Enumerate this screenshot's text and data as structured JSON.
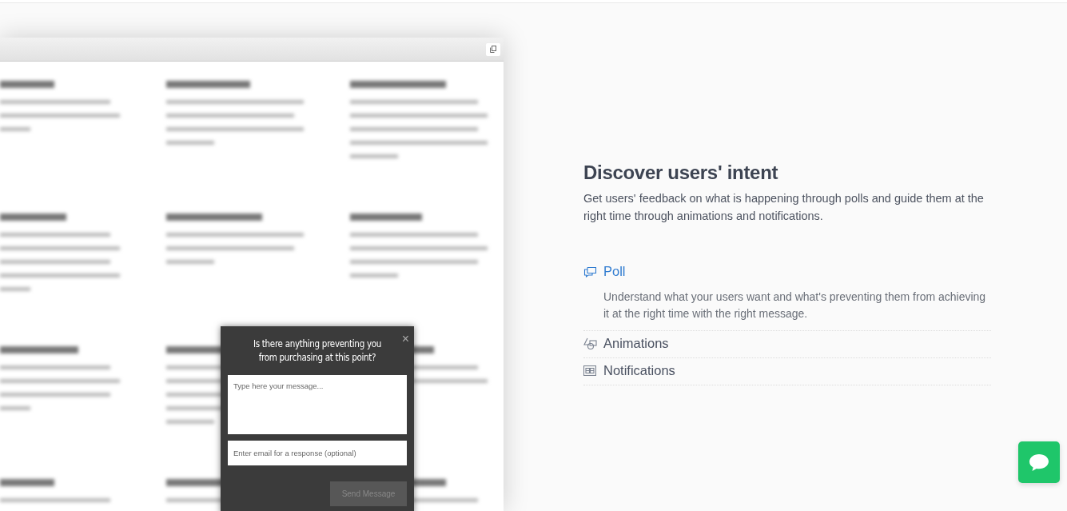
{
  "popup": {
    "title": "Is there anything preventing you from purchasing at this point?",
    "close": "×",
    "message_field": {
      "placeholder": "Type here your message..."
    },
    "email_field": {
      "placeholder": "Enter email for a response (optional)"
    },
    "send_button": "Send Message"
  },
  "feature": {
    "title": "Discover users' intent",
    "description": "Get users' feedback on what is happening through polls and guide them at the right time through animations and notifications.",
    "items": [
      {
        "kind": "poll",
        "label": "Poll",
        "selected": true,
        "description": "Understand what your users want and what's preventing them from achieving it at the right time with the right message."
      },
      {
        "kind": "animations",
        "label": "Animations",
        "selected": false
      },
      {
        "kind": "notifications",
        "label": "Notifications",
        "selected": false
      }
    ]
  }
}
